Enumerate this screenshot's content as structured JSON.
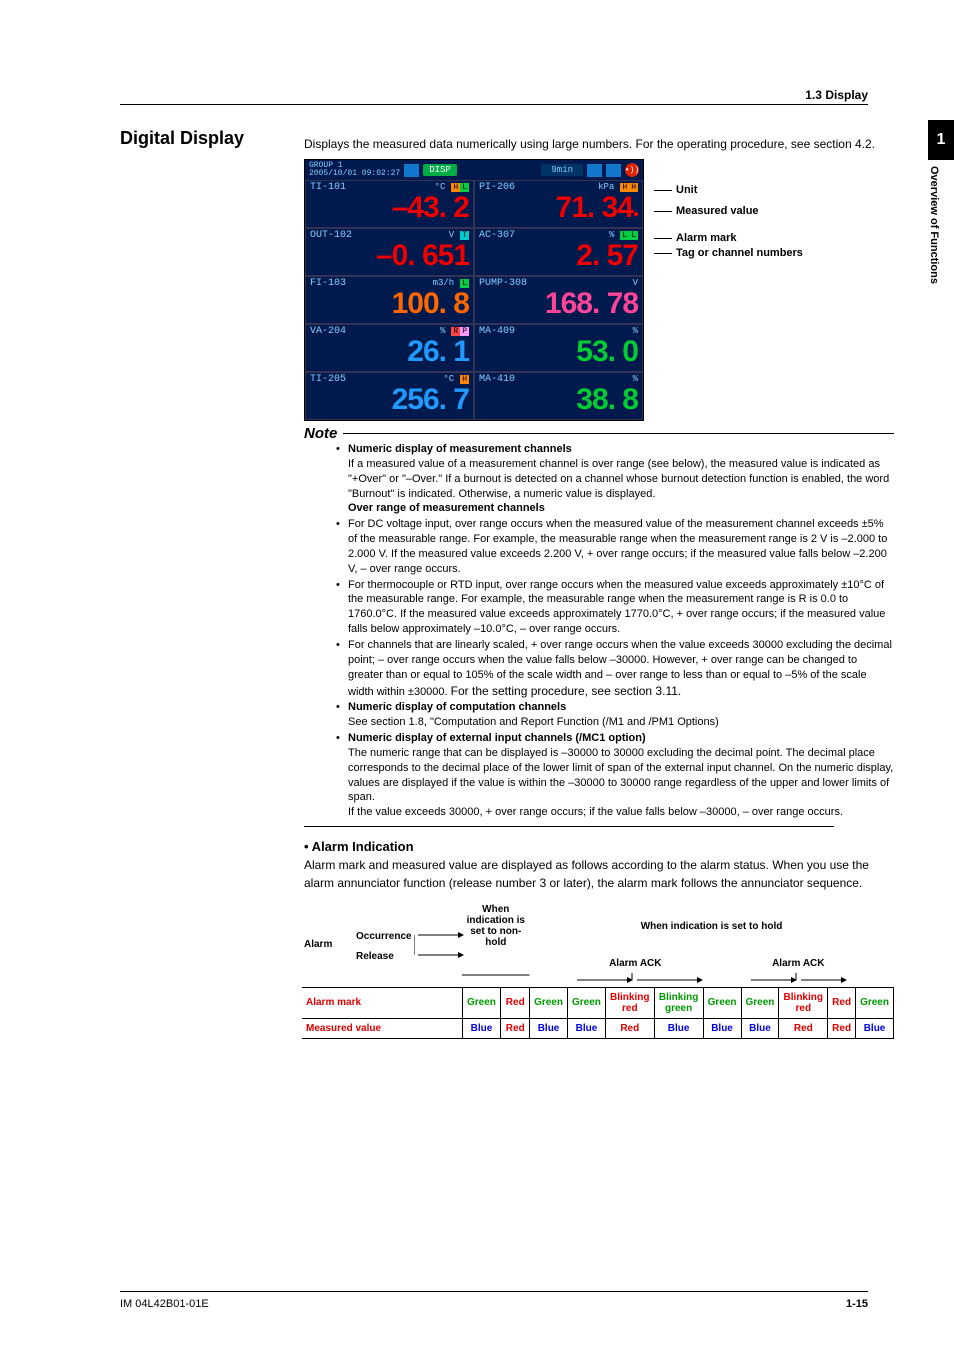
{
  "header": {
    "section": "1.3  Display"
  },
  "sideTab": {
    "number": "1",
    "label": "Overview of Functions"
  },
  "title": "Digital Display",
  "intro": "Displays the measured data numerically using large numbers. For the operating procedure, see section 4.2.",
  "deviceTop": {
    "group": "GROUP 1",
    "timestamp": "2005/10/01 09:02:27",
    "dispBtn": "DISP",
    "rate": "9min"
  },
  "cells": [
    {
      "tag": "TI-101",
      "unit": "°C",
      "badges": [
        "H",
        "L"
      ],
      "value": "–43. 2",
      "cls": "c-red"
    },
    {
      "tag": "PI-206",
      "unit": "kPa",
      "badges": [
        "H",
        "H"
      ],
      "value": "71. 34",
      "cls": "c-red",
      "alarmDot": true
    },
    {
      "tag": "OUT-102",
      "unit": "V",
      "badges": [
        "T"
      ],
      "value": "–0. 651",
      "cls": "c-red"
    },
    {
      "tag": "AC-307",
      "unit": "%",
      "badges": [
        "L",
        "L"
      ],
      "value": "2. 57",
      "cls": "c-red"
    },
    {
      "tag": "FI-103",
      "unit": "m3/h",
      "badges": [
        "L"
      ],
      "value": "100. 8",
      "cls": "c-org"
    },
    {
      "tag": "PUMP-308",
      "unit": "V",
      "badges": [],
      "value": "168. 78",
      "cls": "c-pnk"
    },
    {
      "tag": "VA-204",
      "unit": "%",
      "badges": [
        "R",
        "P"
      ],
      "value": "26. 1",
      "cls": "c-blue"
    },
    {
      "tag": "MA-409",
      "unit": "%",
      "badges": [],
      "value": "53. 0",
      "cls": "c-grn"
    },
    {
      "tag": "TI-205",
      "unit": "°C",
      "badges": [
        "H"
      ],
      "value": "256. 7",
      "cls": "c-blue"
    },
    {
      "tag": "MA-410",
      "unit": "%",
      "badges": [],
      "value": "38. 8",
      "cls": "c-grn"
    }
  ],
  "callouts": {
    "unit": "Unit",
    "measured": "Measured value",
    "alarm": "Alarm mark",
    "tag": "Tag or channel numbers"
  },
  "noteTitle": "Note",
  "note": {
    "h1": "Numeric display of measurement channels",
    "p1": "If a measured value of a measurement channel is over range (see below), the measured value is indicated as \"+Over\" or \"–Over.\" If a burnout is detected on a channel whose burnout detection function is enabled, the word \"Burnout\" is indicated. Otherwise, a numeric value is displayed.",
    "h2": "Over range of measurement channels",
    "b1": "For DC voltage input, over range occurs when the measured value of the measurement channel exceeds ±5% of the measurable range. For example, the measurable range when the measurement range is 2 V is –2.000 to 2.000 V. If the measured value exceeds 2.200 V, + over range occurs; if the measured value falls below –2.200 V, – over range occurs.",
    "b2": "For thermocouple or RTD input, over range occurs when the measured value exceeds approximately ±10°C of the measurable range. For example, the measurable range when the measurement range is R is 0.0 to 1760.0°C. If the measured value exceeds approximately 1770.0°C, + over range occurs; if the measured value falls below approximately –10.0°C, – over range occurs.",
    "b3a": "For channels that are linearly scaled, + over range occurs when the value exceeds 30000 excluding the decimal point; – over range occurs when the value falls below –30000. However, + over range can be changed to greater than or equal to 105% of the scale width and – over range to less than or equal to –5% of the scale width within ±30000. ",
    "b3b": "For the setting procedure, see section 3.11.",
    "h3": "Numeric display of computation channels",
    "p3": "See section 1.8, \"Computation and Report Function (/M1 and /PM1 Options)",
    "h4": "Numeric display of external input channels (/MC1 option)",
    "p4": "The numeric range that can be displayed is –30000 to 30000 excluding the decimal point. The decimal place corresponds to the decimal place of the lower limit of span of the external input channel. On the numeric display, values are displayed if the value is within the –30000 to 30000 range regardless of the upper and lower limits of span.",
    "p5": "If the value exceeds 30000, + over range occurs; if the value falls below –30000, – over range occurs."
  },
  "alarmSection": {
    "heading": "•  Alarm Indication",
    "para": "Alarm mark and measured value are displayed as follows according to the alarm status. When you use the alarm annunciator function (release number 3 or later), the alarm mark follows the annunciator sequence."
  },
  "alarmTable": {
    "hdrNonHold": "When indication is set to non-hold",
    "hdrHold": "When indication is set to hold",
    "ack": "Alarm ACK",
    "rowLabels": {
      "alarm": "Alarm",
      "occurrence": "Occurrence",
      "release": "Release",
      "mark": "Alarm mark",
      "value": "Measured value"
    },
    "cells": {
      "markRow": [
        "Green",
        "Red",
        "Green",
        "Green",
        "Blinking red",
        "Blinking green",
        "Green",
        "Green",
        "Blinking red",
        "Red",
        "Green"
      ],
      "valueRow": [
        "Blue",
        "Red",
        "Blue",
        "Blue",
        "Red",
        "Blue",
        "Blue",
        "Blue",
        "Red",
        "Red",
        "Blue"
      ]
    }
  },
  "footer": {
    "left": "IM 04L42B01-01E",
    "right": "1-15"
  }
}
